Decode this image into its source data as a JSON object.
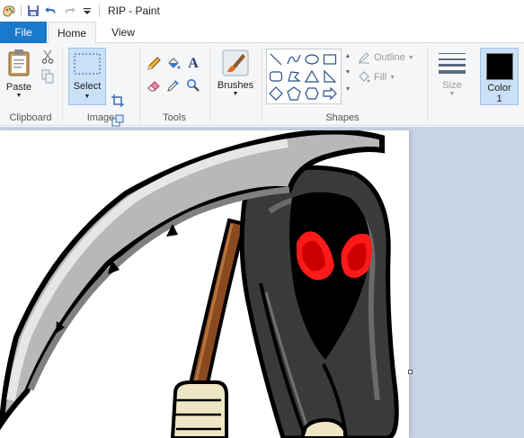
{
  "app": {
    "title": "RIP - Paint"
  },
  "quick_access": {
    "icons": [
      "paint-app-icon",
      "save-icon",
      "undo-icon",
      "redo-icon",
      "customize-dropdown-icon"
    ]
  },
  "tabs": [
    {
      "label": "File"
    },
    {
      "label": "Home"
    },
    {
      "label": "View"
    }
  ],
  "ribbon": {
    "clipboard": {
      "paste_label": "Paste",
      "group_label": "Clipboard"
    },
    "image": {
      "select_label": "Select",
      "group_label": "Image"
    },
    "tools": {
      "group_label": "Tools",
      "text_tool_glyph": "A"
    },
    "brushes": {
      "label": "Brushes"
    },
    "shapes": {
      "outline_label": "Outline",
      "fill_label": "Fill",
      "group_label": "Shapes"
    },
    "size": {
      "label": "Size"
    },
    "color1": {
      "label_line1": "Color",
      "label_line2": "1",
      "color": "#000000"
    }
  },
  "colors": {
    "file_tab": "#1979ca",
    "ribbon_bg": "#f5f6f7",
    "workspace_bg": "#c8d3e5",
    "selected_bg": "#c9e0f7",
    "reaper_eyes": "#ff1a1a"
  }
}
